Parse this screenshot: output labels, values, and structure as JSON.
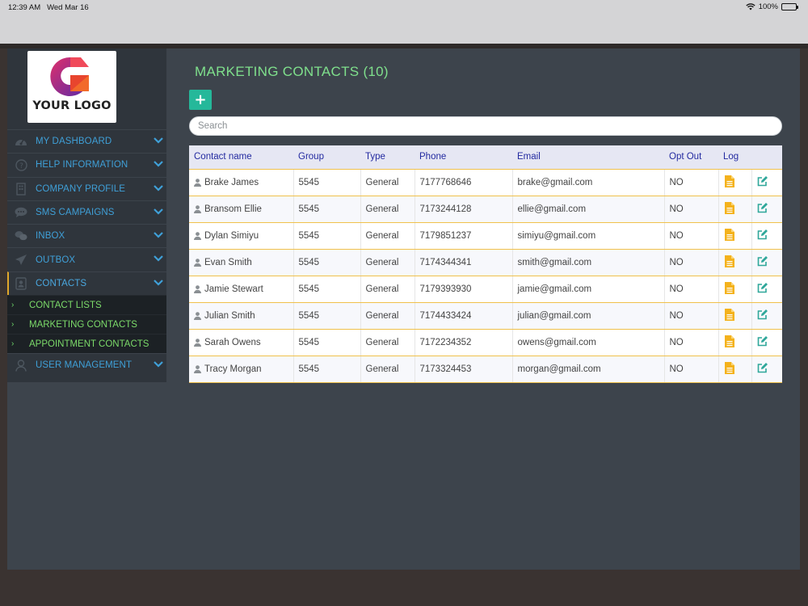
{
  "status_bar": {
    "time": "12:39 AM",
    "date": "Wed Mar 16",
    "battery": "100%"
  },
  "logo": {
    "text": "YOUR LOGO"
  },
  "sidebar": {
    "items": [
      {
        "label": "MY DASHBOARD",
        "icon": "dashboard-icon"
      },
      {
        "label": "HELP INFORMATION",
        "icon": "question-icon"
      },
      {
        "label": "COMPANY PROFILE",
        "icon": "building-icon"
      },
      {
        "label": "SMS CAMPAIGNS",
        "icon": "chat-bubble-icon"
      },
      {
        "label": "INBOX",
        "icon": "chat-bubbles-icon"
      },
      {
        "label": "OUTBOX",
        "icon": "paper-plane-icon"
      },
      {
        "label": "CONTACTS",
        "icon": "contact-card-icon"
      },
      {
        "label": "USER MANAGEMENT",
        "icon": "user-icon"
      }
    ],
    "contacts_sub": [
      {
        "label": "CONTACT LISTS"
      },
      {
        "label": "MARKETING CONTACTS"
      },
      {
        "label": "APPOINTMENT CONTACTS"
      }
    ]
  },
  "main": {
    "title": "MARKETING CONTACTS (10)",
    "add_label": "+",
    "search_placeholder": "Search",
    "columns": [
      "Contact name",
      "Group",
      "Type",
      "Phone",
      "Email",
      "Opt Out",
      "Log"
    ],
    "rows": [
      {
        "name": "Brake James",
        "group": "5545",
        "type": "General",
        "phone": "7177768646",
        "email": "brake@gmail.com",
        "opt_out": "NO"
      },
      {
        "name": "Bransom Ellie",
        "group": "5545",
        "type": "General",
        "phone": "7173244128",
        "email": "ellie@gmail.com",
        "opt_out": "NO"
      },
      {
        "name": "Dylan Simiyu",
        "group": "5545",
        "type": "General",
        "phone": "7179851237",
        "email": "simiyu@gmail.com",
        "opt_out": "NO"
      },
      {
        "name": "Evan Smith",
        "group": "5545",
        "type": "General",
        "phone": "7174344341",
        "email": "smith@gmail.com",
        "opt_out": "NO"
      },
      {
        "name": "Jamie Stewart",
        "group": "5545",
        "type": "General",
        "phone": "7179393930",
        "email": "jamie@gmail.com",
        "opt_out": "NO"
      },
      {
        "name": "Julian Smith",
        "group": "5545",
        "type": "General",
        "phone": "7174433424",
        "email": "julian@gmail.com",
        "opt_out": "NO"
      },
      {
        "name": "Sarah Owens",
        "group": "5545",
        "type": "General",
        "phone": "7172234352",
        "email": "owens@gmail.com",
        "opt_out": "NO"
      },
      {
        "name": "Tracy Morgan",
        "group": "5545",
        "type": "General",
        "phone": "7173324453",
        "email": "morgan@gmail.com",
        "opt_out": "NO"
      }
    ]
  },
  "colors": {
    "title_green": "#7fe08c",
    "nav_blue": "#3fa0d8",
    "sub_green": "#7cdb6a",
    "log_orange": "#f4b21c",
    "edit_teal": "#2fa79a",
    "header_blue": "#232aa0",
    "row_border": "#f0c14b"
  }
}
